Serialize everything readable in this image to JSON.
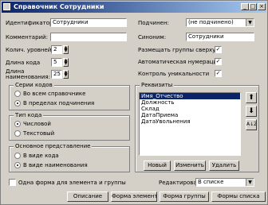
{
  "window": {
    "title": "Справочник Сотрудники",
    "buttons": [
      "_",
      "□",
      "×"
    ]
  },
  "fields": {
    "identifier_label": "Идентификатор:",
    "identifier_value": "Сотрудники",
    "comment_label": "Комментарий:",
    "comment_value": "",
    "synonym_label": "Синоним:",
    "synonym_value": "Сотрудники",
    "subordinate_label": "Подчинен:",
    "subordinate_value": "(не подчинено)",
    "levels_label": "Колич. уровней:",
    "levels_value": "2",
    "code_len_label": "Длина кода",
    "code_len_value": "5",
    "name_len_label": "Длина наименования:",
    "name_len_value": "25"
  },
  "checkboxes": [
    {
      "label": "Размещать группы сверху",
      "checked": true
    },
    {
      "label": "Автоматическая нумерация",
      "checked": true
    },
    {
      "label": "Контроль уникальности",
      "checked": true
    }
  ],
  "series_code": {
    "title": "Серии кодов",
    "options": [
      "Во всем справочнике",
      "В пределах подчинения"
    ],
    "selected": 1
  },
  "code_type": {
    "title": "Тип кода",
    "options": [
      "Числовой",
      "Текстовый"
    ],
    "selected": 0
  },
  "main_view": {
    "title": "Основное представление",
    "options": [
      "В виде кода",
      "В виде наименования"
    ],
    "selected": 1
  },
  "attributes": {
    "title": "Реквизиты",
    "items": [
      "Имя_Отчество",
      "Должность",
      "Склад",
      "ДатаПриема",
      "ДатаУвольнения"
    ],
    "selected": 0,
    "new_label": "Новый",
    "edit_label": "Изменить",
    "delete_label": "Удалить",
    "up_icon": "arrow-up",
    "down_icon": "arrow-down",
    "sort_icon": "sort-az"
  },
  "one_form_label": "Одна форма для элемента и группы",
  "one_form_checked": false,
  "edit_label": "Редактировать:",
  "edit_value": "В списке",
  "bottom_buttons": [
    "Описание",
    "Форма элемента",
    "Форма группы",
    "Формы списка"
  ],
  "colors": {
    "face": "#d4d0c8",
    "title_start": "#0a246a",
    "title_end": "#a6caf0",
    "selection": "#0a246a"
  }
}
